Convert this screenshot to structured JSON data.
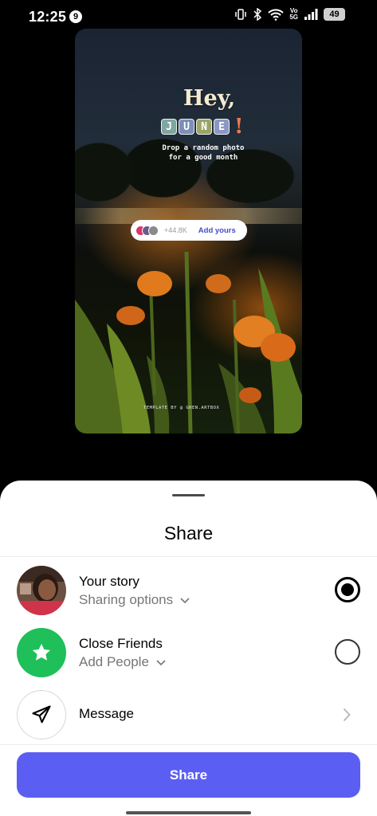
{
  "status_bar": {
    "time": "12:25",
    "notification_count": "9",
    "volte_label": "Vo\n5G",
    "battery": "49"
  },
  "story": {
    "greeting": "Hey,",
    "greeting_mark": "!",
    "month_letters": [
      "J",
      "U",
      "N",
      "E"
    ],
    "month_tile_colors": [
      "#7fa6a0",
      "#7c8fb6",
      "#9aa667",
      "#8d98c2"
    ],
    "caption": "Drop a random photo for a good month",
    "add_yours": {
      "count": "+44.8K",
      "label": "Add yours"
    },
    "template_credit": "TEMPLATE BY @ GHEN.ARTBOX"
  },
  "sheet": {
    "title": "Share",
    "options": [
      {
        "title": "Your story",
        "subtitle": "Sharing options",
        "selected": true,
        "icon": "profile-photo"
      },
      {
        "title": "Close Friends",
        "subtitle": "Add People",
        "selected": false,
        "icon": "star-icon",
        "icon_color": "#1fbf5a"
      },
      {
        "title": "Message",
        "icon": "paper-plane-icon"
      }
    ],
    "share_button": "Share",
    "accent_color": "#5b5ef2"
  }
}
